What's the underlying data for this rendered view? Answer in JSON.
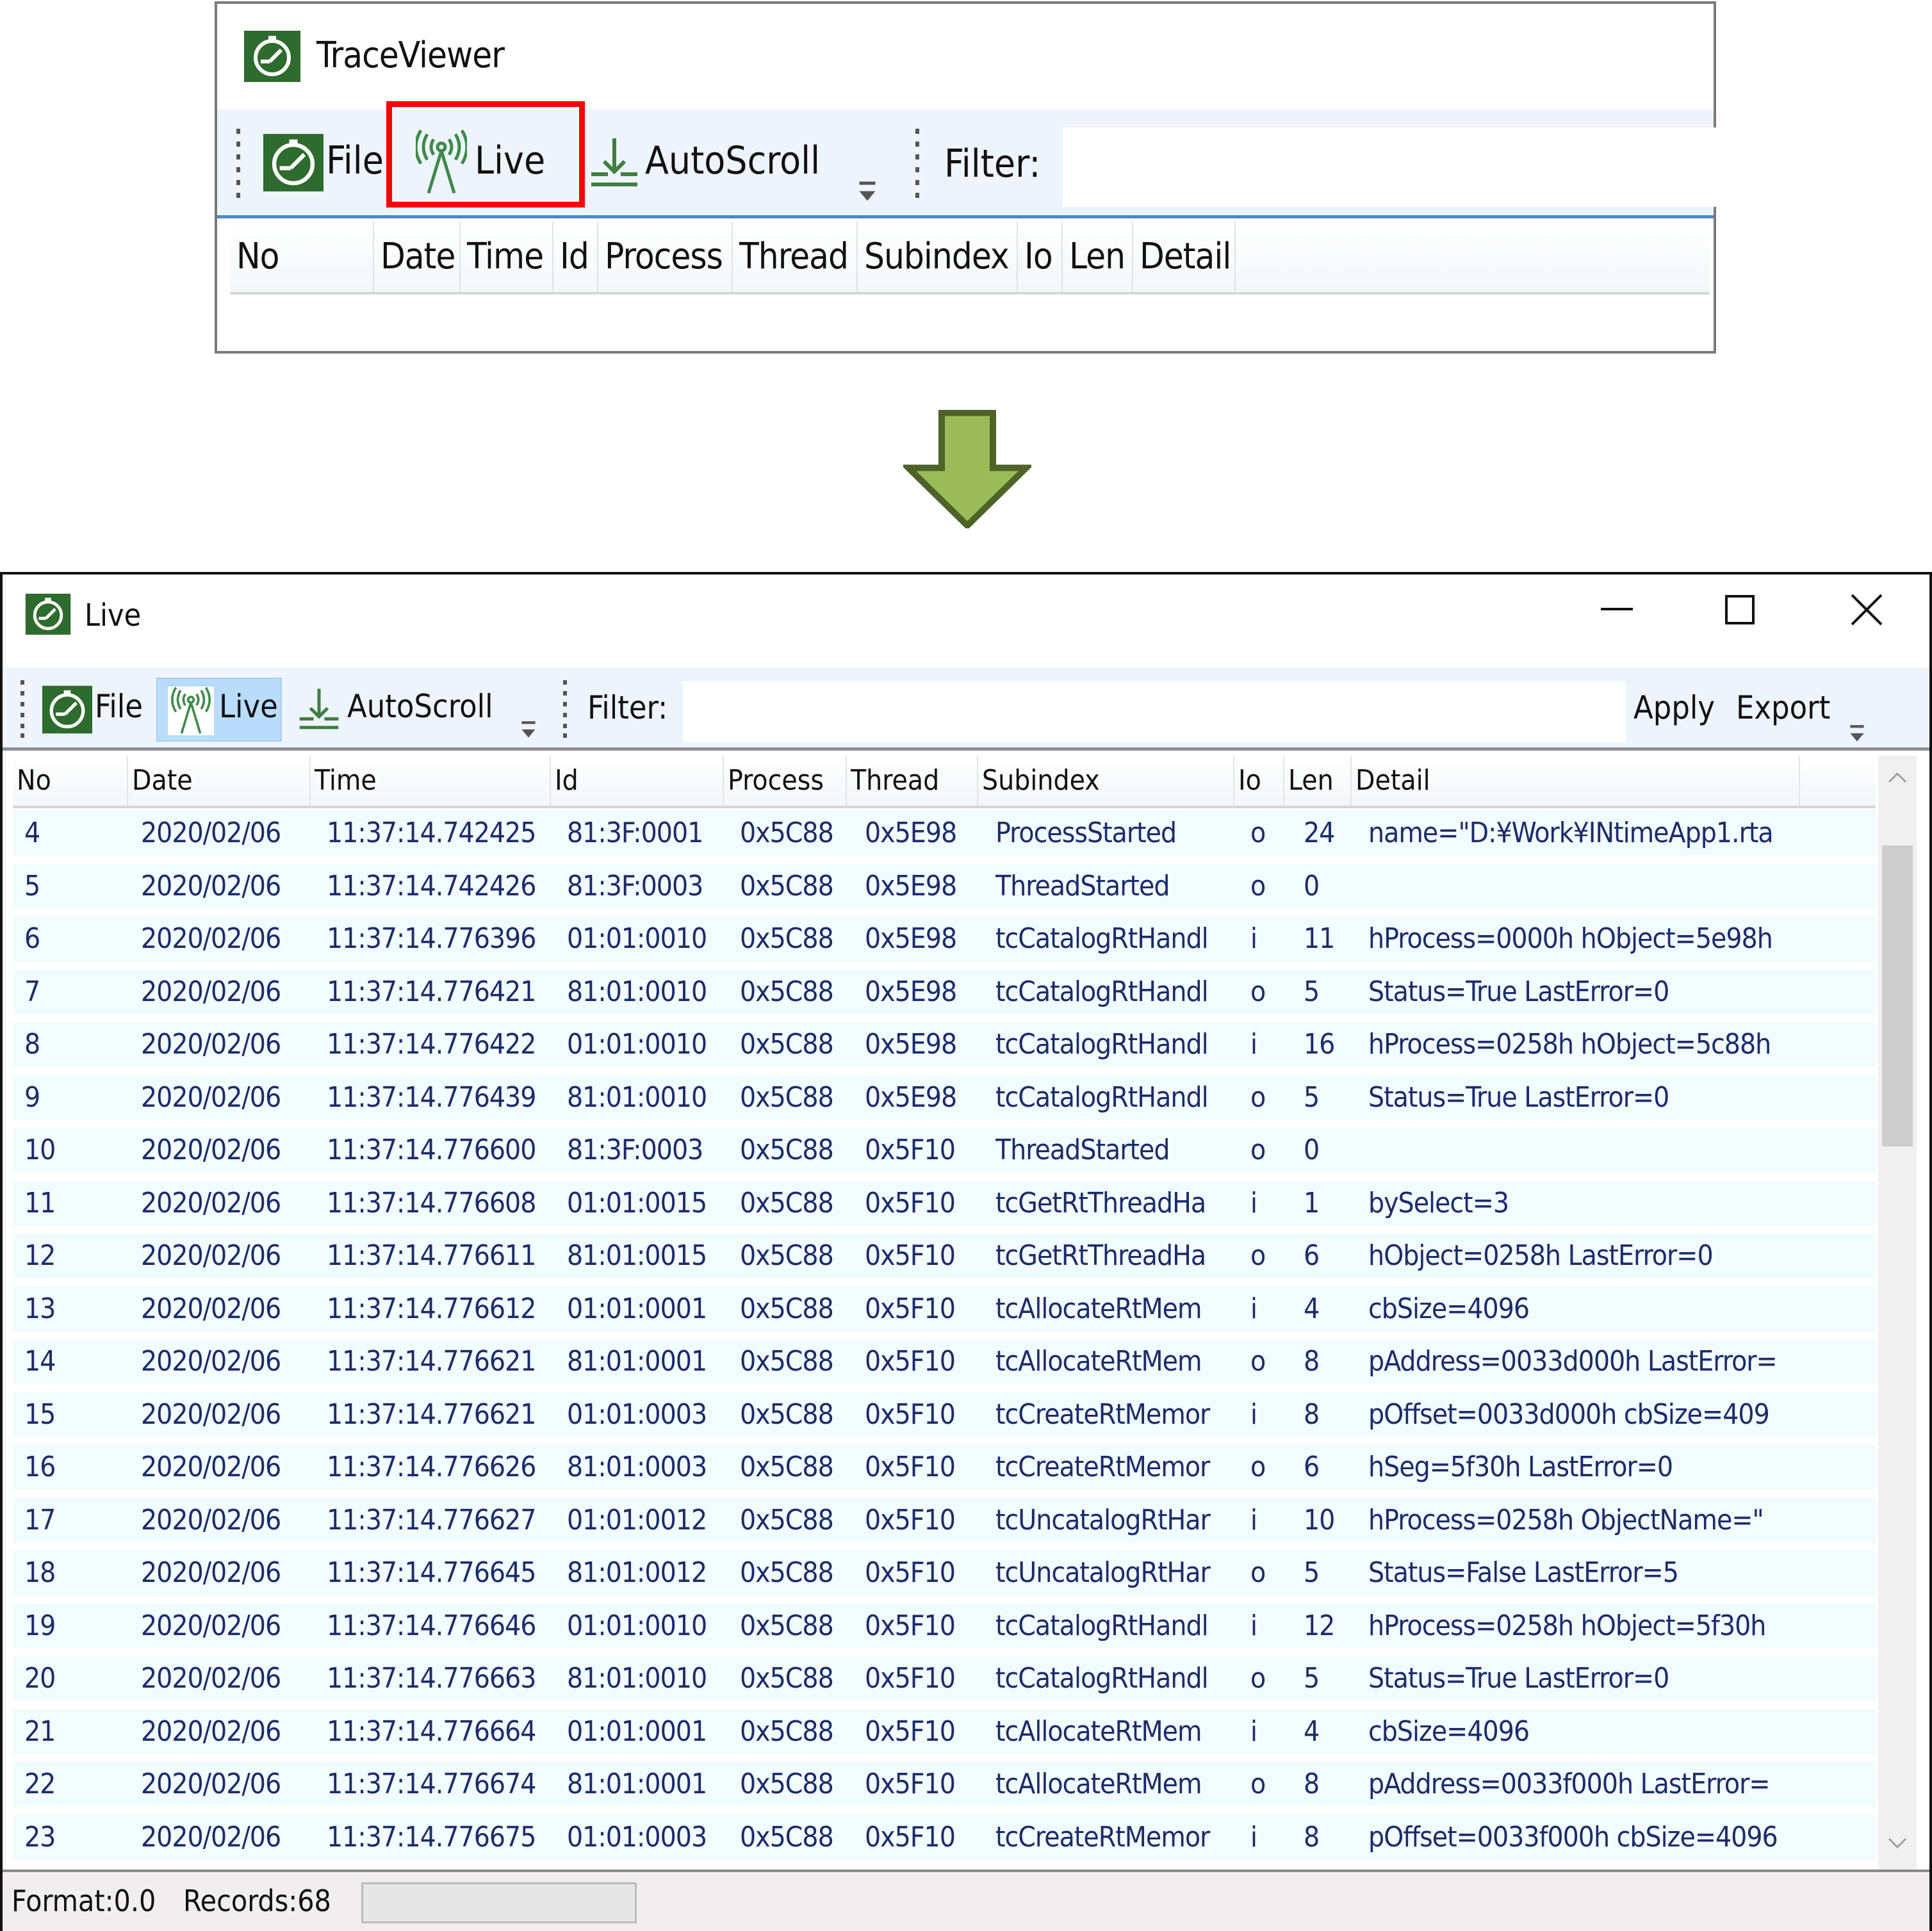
{
  "top_window": {
    "title": "TraceViewer",
    "toolbar": {
      "file_label": "File",
      "live_label": "Live",
      "autoscroll_label": "AutoScroll",
      "filter_label": "Filter:",
      "filter_value": ""
    },
    "columns": [
      "No",
      "Date",
      "Time",
      "Id",
      "Process",
      "Thread",
      "Subindex",
      "Io",
      "Len",
      "Detail"
    ]
  },
  "annotation": {
    "highlight_color": "#ff0000",
    "arrow_fill": "#9bbb59",
    "arrow_stroke": "#4f6228"
  },
  "live_window": {
    "title": "Live",
    "window_controls": {
      "minimize": "minimize-icon",
      "maximize": "maximize-icon",
      "close": "close-icon"
    },
    "toolbar": {
      "file_label": "File",
      "live_label": "Live",
      "autoscroll_label": "AutoScroll",
      "filter_label": "Filter:",
      "filter_value": "",
      "apply_label": "Apply",
      "export_label": "Export"
    },
    "columns": [
      "No",
      "Date",
      "Time",
      "Id",
      "Process",
      "Thread",
      "Subindex",
      "Io",
      "Len",
      "Detail"
    ],
    "rows": [
      [
        "4",
        "2020/02/06",
        "11:37:14.742425",
        "81:3F:0001",
        "0x5C88",
        "0x5E98",
        "ProcessStarted",
        "o",
        "24",
        "name=\"D:¥Work¥INtimeApp1.rta"
      ],
      [
        "5",
        "2020/02/06",
        "11:37:14.742426",
        "81:3F:0003",
        "0x5C88",
        "0x5E98",
        "ThreadStarted",
        "o",
        "0",
        ""
      ],
      [
        "6",
        "2020/02/06",
        "11:37:14.776396",
        "01:01:0010",
        "0x5C88",
        "0x5E98",
        "tcCatalogRtHandl",
        "i",
        "11",
        "hProcess=0000h hObject=5e98h"
      ],
      [
        "7",
        "2020/02/06",
        "11:37:14.776421",
        "81:01:0010",
        "0x5C88",
        "0x5E98",
        "tcCatalogRtHandl",
        "o",
        "5",
        "Status=True LastError=0"
      ],
      [
        "8",
        "2020/02/06",
        "11:37:14.776422",
        "01:01:0010",
        "0x5C88",
        "0x5E98",
        "tcCatalogRtHandl",
        "i",
        "16",
        "hProcess=0258h hObject=5c88h"
      ],
      [
        "9",
        "2020/02/06",
        "11:37:14.776439",
        "81:01:0010",
        "0x5C88",
        "0x5E98",
        "tcCatalogRtHandl",
        "o",
        "5",
        "Status=True LastError=0"
      ],
      [
        "10",
        "2020/02/06",
        "11:37:14.776600",
        "81:3F:0003",
        "0x5C88",
        "0x5F10",
        "ThreadStarted",
        "o",
        "0",
        ""
      ],
      [
        "11",
        "2020/02/06",
        "11:37:14.776608",
        "01:01:0015",
        "0x5C88",
        "0x5F10",
        "tcGetRtThreadHa",
        "i",
        "1",
        "bySelect=3"
      ],
      [
        "12",
        "2020/02/06",
        "11:37:14.776611",
        "81:01:0015",
        "0x5C88",
        "0x5F10",
        "tcGetRtThreadHa",
        "o",
        "6",
        "hObject=0258h LastError=0"
      ],
      [
        "13",
        "2020/02/06",
        "11:37:14.776612",
        "01:01:0001",
        "0x5C88",
        "0x5F10",
        "tcAllocateRtMem",
        "i",
        "4",
        "cbSize=4096"
      ],
      [
        "14",
        "2020/02/06",
        "11:37:14.776621",
        "81:01:0001",
        "0x5C88",
        "0x5F10",
        "tcAllocateRtMem",
        "o",
        "8",
        "pAddress=0033d000h LastError="
      ],
      [
        "15",
        "2020/02/06",
        "11:37:14.776621",
        "01:01:0003",
        "0x5C88",
        "0x5F10",
        "tcCreateRtMemor",
        "i",
        "8",
        "pOffset=0033d000h cbSize=409"
      ],
      [
        "16",
        "2020/02/06",
        "11:37:14.776626",
        "81:01:0003",
        "0x5C88",
        "0x5F10",
        "tcCreateRtMemor",
        "o",
        "6",
        "hSeg=5f30h LastError=0"
      ],
      [
        "17",
        "2020/02/06",
        "11:37:14.776627",
        "01:01:0012",
        "0x5C88",
        "0x5F10",
        "tcUncatalogRtHar",
        "i",
        "10",
        "hProcess=0258h ObjectName=\""
      ],
      [
        "18",
        "2020/02/06",
        "11:37:14.776645",
        "81:01:0012",
        "0x5C88",
        "0x5F10",
        "tcUncatalogRtHar",
        "o",
        "5",
        "Status=False LastError=5"
      ],
      [
        "19",
        "2020/02/06",
        "11:37:14.776646",
        "01:01:0010",
        "0x5C88",
        "0x5F10",
        "tcCatalogRtHandl",
        "i",
        "12",
        "hProcess=0258h hObject=5f30h"
      ],
      [
        "20",
        "2020/02/06",
        "11:37:14.776663",
        "81:01:0010",
        "0x5C88",
        "0x5F10",
        "tcCatalogRtHandl",
        "o",
        "5",
        "Status=True LastError=0"
      ],
      [
        "21",
        "2020/02/06",
        "11:37:14.776664",
        "01:01:0001",
        "0x5C88",
        "0x5F10",
        "tcAllocateRtMem",
        "i",
        "4",
        "cbSize=4096"
      ],
      [
        "22",
        "2020/02/06",
        "11:37:14.776674",
        "81:01:0001",
        "0x5C88",
        "0x5F10",
        "tcAllocateRtMem",
        "o",
        "8",
        "pAddress=0033f000h LastError="
      ],
      [
        "23",
        "2020/02/06",
        "11:37:14.776675",
        "01:01:0003",
        "0x5C88",
        "0x5F10",
        "tcCreateRtMemor",
        "i",
        "8",
        "pOffset=0033f000h cbSize=4096"
      ]
    ],
    "status": {
      "format": "Format:0.0",
      "records": "Records:68"
    },
    "colors": {
      "row_bg": "#f0fcfe",
      "cell_text": "#1f2a6b",
      "selected_button_bg": "#b9dcfb",
      "toolbar_bg": "#eef4fc",
      "icon_green": "#2e6b2e"
    }
  }
}
